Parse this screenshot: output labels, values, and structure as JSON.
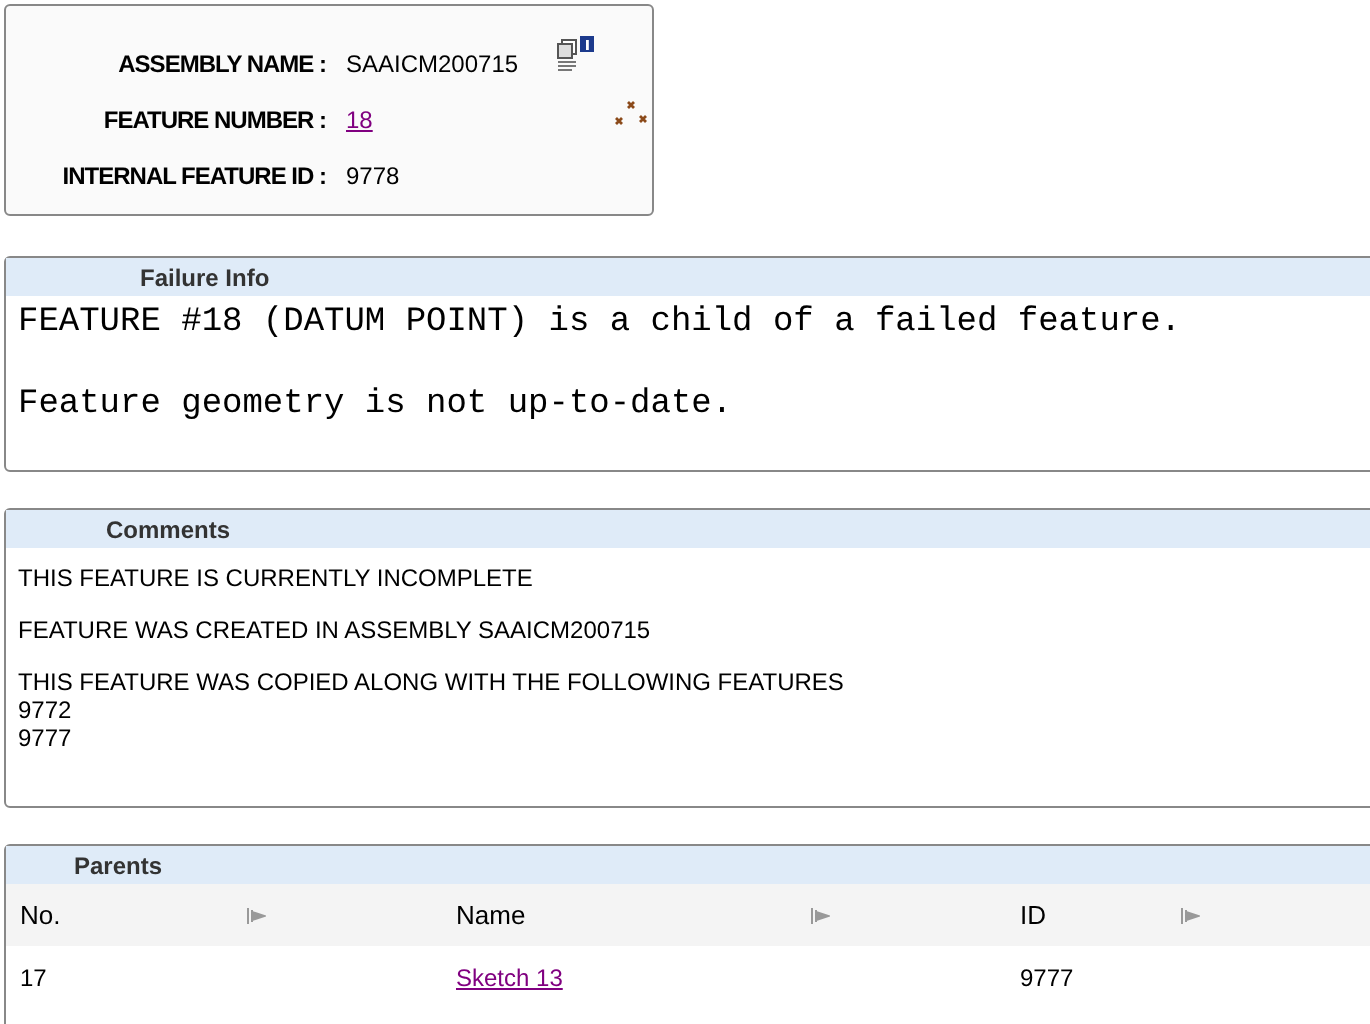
{
  "info": {
    "rows": [
      {
        "label": "ASSEMBLY NAME :",
        "value": "SAAICM200715",
        "kind": "text"
      },
      {
        "label": "FEATURE NUMBER :",
        "value": "18",
        "kind": "link"
      },
      {
        "label": "INTERNAL FEATURE ID :",
        "value": "9778",
        "kind": "text"
      }
    ]
  },
  "failure_info": {
    "title": "Failure Info",
    "lines": [
      "FEATURE #18 (DATUM POINT) is a child of a failed feature.",
      "Feature geometry is not up-to-date."
    ]
  },
  "comments": {
    "title": "Comments",
    "paragraphs": [
      [
        "THIS FEATURE IS CURRENTLY INCOMPLETE"
      ],
      [
        "FEATURE WAS CREATED IN ASSEMBLY SAAICM200715"
      ],
      [
        "THIS FEATURE WAS COPIED ALONG WITH THE FOLLOWING FEATURES",
        "9772",
        "9777"
      ]
    ]
  },
  "parents": {
    "title": "Parents",
    "columns": [
      "No.",
      "Name",
      "ID"
    ],
    "rows": [
      {
        "no": "17",
        "name": "Sketch 13",
        "id": "9777"
      }
    ]
  }
}
